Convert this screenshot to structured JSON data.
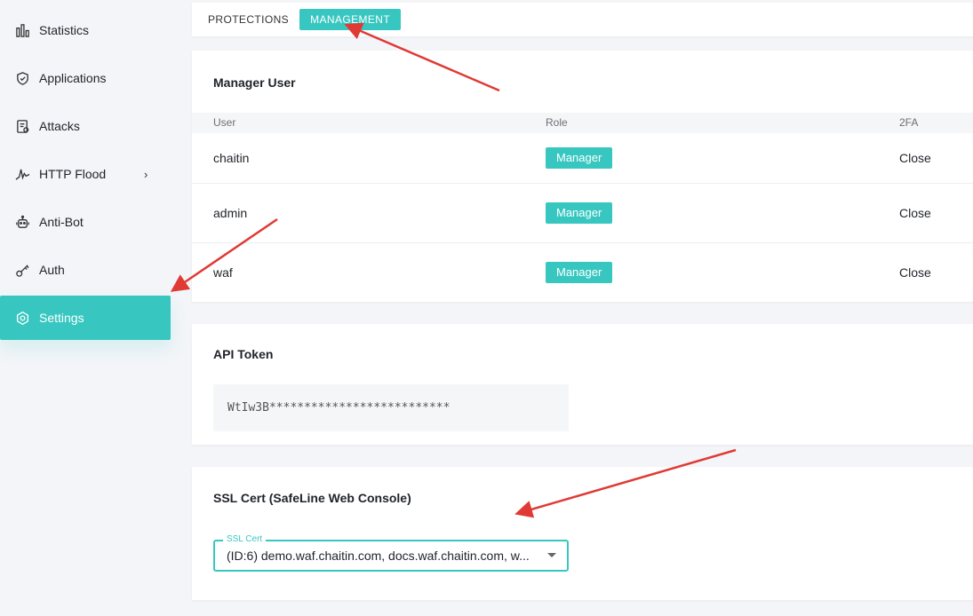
{
  "sidebar": {
    "items": [
      {
        "label": "Statistics",
        "icon": "bar-chart-icon"
      },
      {
        "label": "Applications",
        "icon": "shield-icon"
      },
      {
        "label": "Attacks",
        "icon": "report-icon"
      },
      {
        "label": "HTTP Flood",
        "icon": "pulse-icon",
        "has_submenu": true
      },
      {
        "label": "Anti-Bot",
        "icon": "robot-icon"
      },
      {
        "label": "Auth",
        "icon": "key-icon"
      },
      {
        "label": "Settings",
        "icon": "settings-icon",
        "active": true
      }
    ],
    "chevron": "›"
  },
  "tabs": [
    {
      "label": "PROTECTIONS",
      "active": false
    },
    {
      "label": "MANAGEMENT",
      "active": true
    }
  ],
  "manager_user": {
    "title": "Manager User",
    "columns": [
      "User",
      "Role",
      "2FA"
    ],
    "rows": [
      {
        "user": "chaitin",
        "role": "Manager",
        "twofa": "Close"
      },
      {
        "user": "admin",
        "role": "Manager",
        "twofa": "Close"
      },
      {
        "user": "waf",
        "role": "Manager",
        "twofa": "Close"
      }
    ]
  },
  "api_token": {
    "title": "API Token",
    "value": "WtIw3B**************************"
  },
  "ssl_cert": {
    "title": "SSL Cert (SafeLine Web Console)",
    "field_label": "SSL Cert",
    "value": "(ID:6) demo.waf.chaitin.com, docs.waf.chaitin.com, w..."
  },
  "colors": {
    "accent": "#38c7c0",
    "annotation_arrow": "#e03a35"
  }
}
